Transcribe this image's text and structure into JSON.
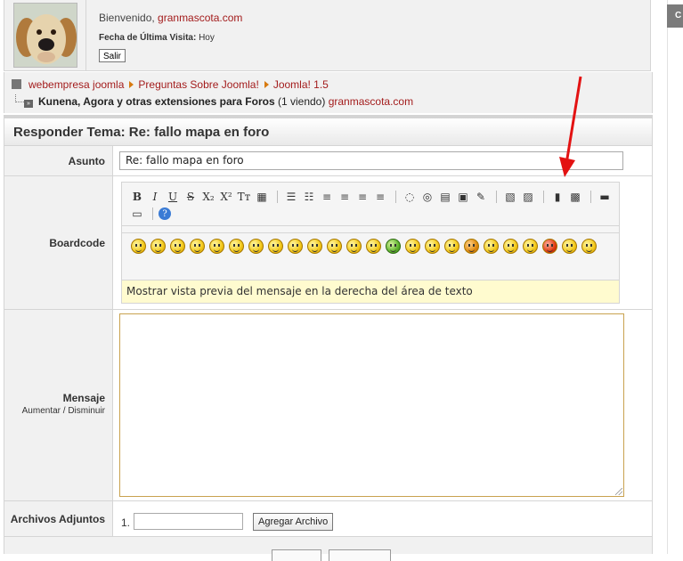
{
  "user_panel": {
    "welcome_prefix": "Bienvenido, ",
    "username": "granmascota.com",
    "last_visit_label": "Fecha de Última Visita:",
    "last_visit_value": "Hoy",
    "logout_label": "Salir"
  },
  "breadcrumb": {
    "items": [
      "webempresa joomla",
      "Preguntas Sobre Joomla!",
      "Joomla! 1.5"
    ],
    "current_forum": "Kunena, Agora y otras extensiones para Foros",
    "viewing": "(1 viendo)",
    "viewer": "granmascota.com"
  },
  "form": {
    "title": "Responder Tema: Re: fallo mapa en foro",
    "subject_label": "Asunto",
    "subject_value": "Re: fallo mapa en foro",
    "boardcode_label": "Boardcode",
    "preview_hint": "Mostrar vista previa del mensaje en la derecha del área de texto",
    "message_label": "Mensaje",
    "message_sizer": "Aumentar / Disminuir",
    "attachments_label": "Archivos Adjuntos",
    "attachment_num": "1.",
    "add_file_label": "Agregar Archivo"
  },
  "toolbar": {
    "row1": [
      "B",
      "I",
      "U",
      "S",
      "X₂",
      "X²",
      "Tт",
      "▦",
      "|",
      "☰",
      "☷",
      "≡",
      "≡",
      "≡",
      "≡",
      "|",
      "◌",
      "◎",
      "▤",
      "▣",
      "✎",
      "|",
      "▧",
      "▨",
      "|",
      "▮",
      "▩",
      "|",
      "▬"
    ],
    "row2": [
      "▭",
      "|",
      "?"
    ]
  },
  "smilies": [
    "cool",
    "sad",
    "smile",
    "grin",
    "happy",
    "wink",
    "tongue",
    "angry",
    "blush",
    "shocked",
    "surprised",
    "eek",
    "laugh",
    "sick",
    "silly",
    "dizzy",
    "grin2",
    "kiss",
    "crazy",
    "razz",
    "frown",
    "devil",
    "think",
    "sleepy"
  ],
  "right_panel": {
    "tab_label": "C"
  },
  "colors": {
    "link": "#a31c1c",
    "panel_bg": "#f1f1f1",
    "preview_bg": "#fffbcf",
    "annotation": "#e31212"
  }
}
